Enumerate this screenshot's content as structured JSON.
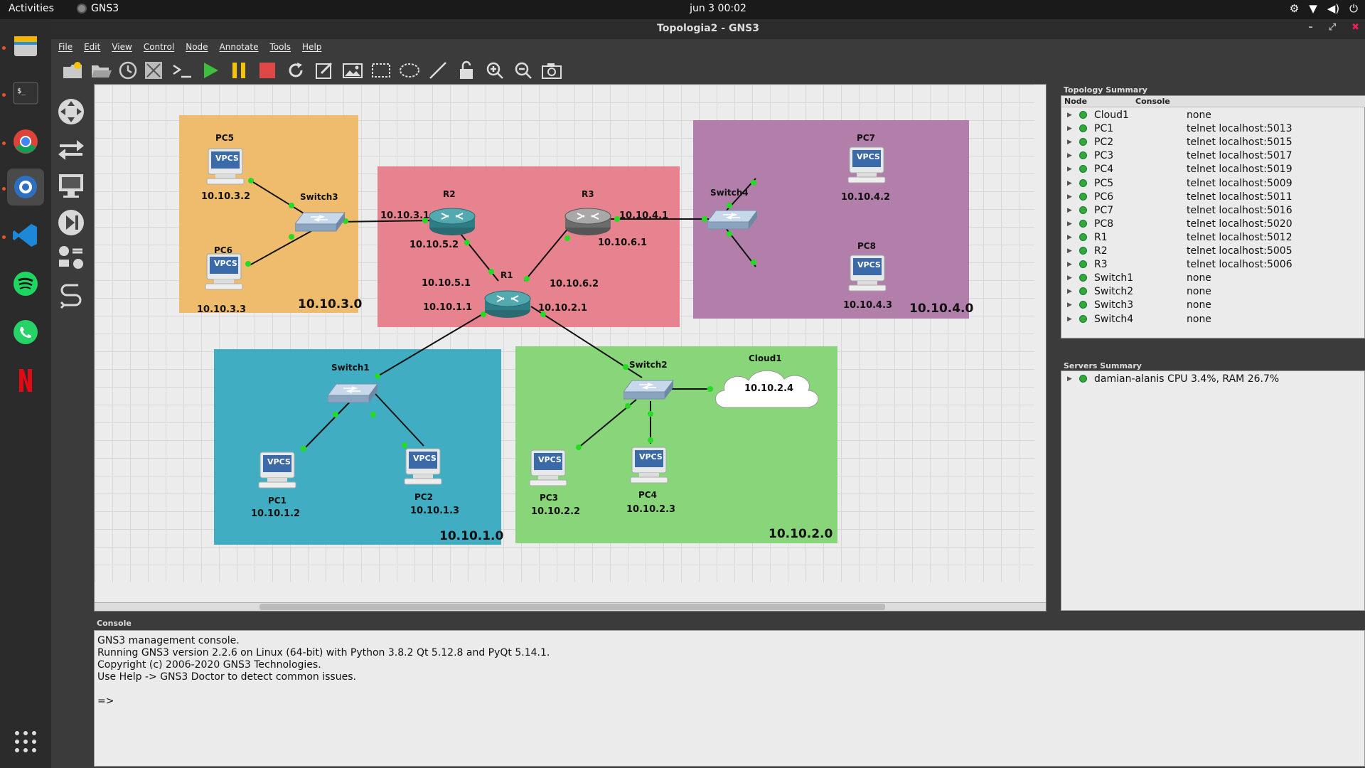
{
  "topbar": {
    "activities": "Activities",
    "app_name": "GNS3",
    "clock": "jun 3  00:02"
  },
  "window": {
    "title": "Topologia2 - GNS3"
  },
  "menu": [
    "File",
    "Edit",
    "View",
    "Control",
    "Node",
    "Annotate",
    "Tools",
    "Help"
  ],
  "topology": {
    "areas": [
      {
        "id": "net3",
        "label": "10.10.3.0",
        "color": "#efbc6e"
      },
      {
        "id": "net-mid",
        "label": "",
        "color": "#e6838e"
      },
      {
        "id": "net4",
        "label": "10.10.4.0",
        "color": "#b17faa"
      },
      {
        "id": "net1",
        "label": "10.10.1.0",
        "color": "#40adc2"
      },
      {
        "id": "net2",
        "label": "10.10.2.0",
        "color": "#88d57a"
      }
    ],
    "nodes": {
      "PC5": {
        "name": "PC5",
        "ip": "10.10.3.2"
      },
      "PC6": {
        "name": "PC6",
        "ip": "10.10.3.3"
      },
      "Switch3": {
        "name": "Switch3"
      },
      "R2": {
        "name": "R2",
        "ip_left": "10.10.3.1",
        "ip_bottom": "10.10.5.2"
      },
      "R3": {
        "name": "R3",
        "ip_right": "10.10.4.1",
        "ip_bottom": "10.10.6.1"
      },
      "R1": {
        "name": "R1",
        "ip_tl": "10.10.5.1",
        "ip_tr": "10.10.6.2",
        "ip_bl": "10.10.1.1",
        "ip_br": "10.10.2.1"
      },
      "Switch4": {
        "name": "Switch4"
      },
      "PC7": {
        "name": "PC7",
        "ip": "10.10.4.2"
      },
      "PC8": {
        "name": "PC8",
        "ip": "10.10.4.3"
      },
      "Switch1": {
        "name": "Switch1"
      },
      "PC1": {
        "name": "PC1",
        "ip": "10.10.1.2"
      },
      "PC2": {
        "name": "PC2",
        "ip": "10.10.1.3"
      },
      "Switch2": {
        "name": "Switch2"
      },
      "Cloud1": {
        "name": "Cloud1",
        "ip": "10.10.2.4"
      },
      "PC3": {
        "name": "PC3",
        "ip": "10.10.2.2"
      },
      "PC4": {
        "name": "PC4",
        "ip": "10.10.2.3"
      }
    },
    "vpcs_label": "VPCS"
  },
  "topology_summary": {
    "title": "Topology Summary",
    "col_node": "Node",
    "col_console": "Console",
    "rows": [
      {
        "node": "Cloud1",
        "console": "none"
      },
      {
        "node": "PC1",
        "console": "telnet localhost:5013"
      },
      {
        "node": "PC2",
        "console": "telnet localhost:5015"
      },
      {
        "node": "PC3",
        "console": "telnet localhost:5017"
      },
      {
        "node": "PC4",
        "console": "telnet localhost:5019"
      },
      {
        "node": "PC5",
        "console": "telnet localhost:5009"
      },
      {
        "node": "PC6",
        "console": "telnet localhost:5011"
      },
      {
        "node": "PC7",
        "console": "telnet localhost:5016"
      },
      {
        "node": "PC8",
        "console": "telnet localhost:5020"
      },
      {
        "node": "R1",
        "console": "telnet localhost:5012"
      },
      {
        "node": "R2",
        "console": "telnet localhost:5005"
      },
      {
        "node": "R3",
        "console": "telnet localhost:5006"
      },
      {
        "node": "Switch1",
        "console": "none"
      },
      {
        "node": "Switch2",
        "console": "none"
      },
      {
        "node": "Switch3",
        "console": "none"
      },
      {
        "node": "Switch4",
        "console": "none"
      }
    ]
  },
  "servers_summary": {
    "title": "Servers Summary",
    "server": "damian-alanis CPU 3.4%, RAM 26.7%"
  },
  "console": {
    "title": "Console",
    "lines": [
      "GNS3 management console.",
      "Running GNS3 version 2.2.6 on Linux (64-bit) with Python 3.8.2 Qt 5.12.8 and PyQt 5.14.1.",
      "Copyright (c) 2006-2020 GNS3 Technologies.",
      "Use Help -> GNS3 Doctor to detect common issues.",
      "",
      "=>"
    ]
  },
  "colors": {
    "link_dot": "#22dd22",
    "led_green": "#33aa33"
  }
}
